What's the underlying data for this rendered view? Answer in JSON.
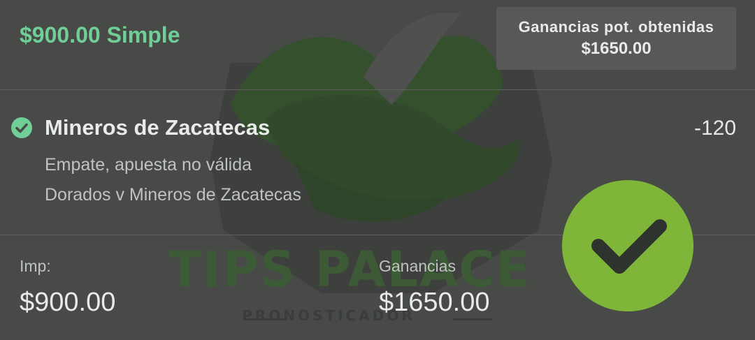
{
  "bet": {
    "title": "$900.00 Simple",
    "potential_winnings_label": "Ganancias pot. obtenidas",
    "potential_winnings_value": "$1650.00"
  },
  "selection": {
    "team": "Mineros de Zacatecas",
    "odds": "-120",
    "result": "Empate, apuesta no válida",
    "match": "Dorados v Mineros de Zacatecas"
  },
  "summary": {
    "stake_label": "Imp:",
    "stake_value": "$900.00",
    "winnings_label": "Ganancias",
    "winnings_value": "$1650.00"
  },
  "watermark": {
    "title": "TIPS PALACE",
    "subtitle": "PRONOSTICADOR"
  },
  "icons": {
    "status": "check-circle-icon",
    "badge": "large-check-badge-icon"
  },
  "colors": {
    "accent_green": "#6fcf97",
    "badge_green": "#7fb539",
    "background": "#474a47"
  }
}
